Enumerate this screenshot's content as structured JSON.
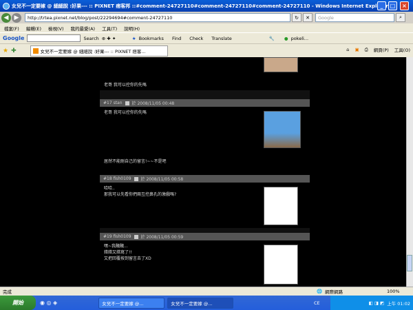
{
  "window": {
    "title": "女兒不一定要嫁 @ 細細說 :好果--- :: PIXNET 痞客邦 ::#comment-24727110#comment-24727110#comment-24727110 - Windows Internet Explorer"
  },
  "address": {
    "url": "http://trtea.pixnet.net/blog/post/22294694#comment-24727110",
    "search_placeholder": "Google"
  },
  "menu": [
    "檔案(F)",
    "編輯(E)",
    "檢視(V)",
    "我的最愛(A)",
    "工具(T)",
    "說明(H)"
  ],
  "google_toolbar": {
    "logo": "Google",
    "search_label": "Search",
    "bookmarks": "Bookmarks",
    "find": "Find",
    "check": "Check",
    "translate": "Translate",
    "user": "pokeli..."
  },
  "tab": {
    "label": "女兒不一定要嫁 @ 細細說 :好果--- :: PIXNET 痞客..."
  },
  "tools": {
    "page": "網頁(P)",
    "tools": "工具(O)"
  },
  "comments": [
    {
      "text": "老哥 我可以控你的先嗎"
    },
    {
      "header": "#17 stan",
      "date": "於 2008/11/05 00:48",
      "text1": "老哥 我可以控你的先嗎",
      "text2": "居然不能刪自己的留言!~~不是吧"
    },
    {
      "header": "#18 fish0109",
      "date": "於 2008/11/05 00:58",
      "text1": "哈哈..",
      "text2": "那我可以先看你們兩互控鼻孔的激戲嗎?"
    },
    {
      "header": "#19 fish0109",
      "date": "於 2008/11/05 00:59",
      "text1": "嘿~我醜醜...",
      "text2": "錯錯又錯寫了!!",
      "text3": "又把回覆按到留言去了XD"
    }
  ],
  "status": {
    "left": "完成",
    "zone": "網際網路",
    "zoom": "100%"
  },
  "taskbar": {
    "start": "開始",
    "tasks": [
      "女兒不一定要嫁 @...",
      "女兒不一定要嫁 @..."
    ],
    "lang": "CE",
    "time": "上午 01:02"
  }
}
